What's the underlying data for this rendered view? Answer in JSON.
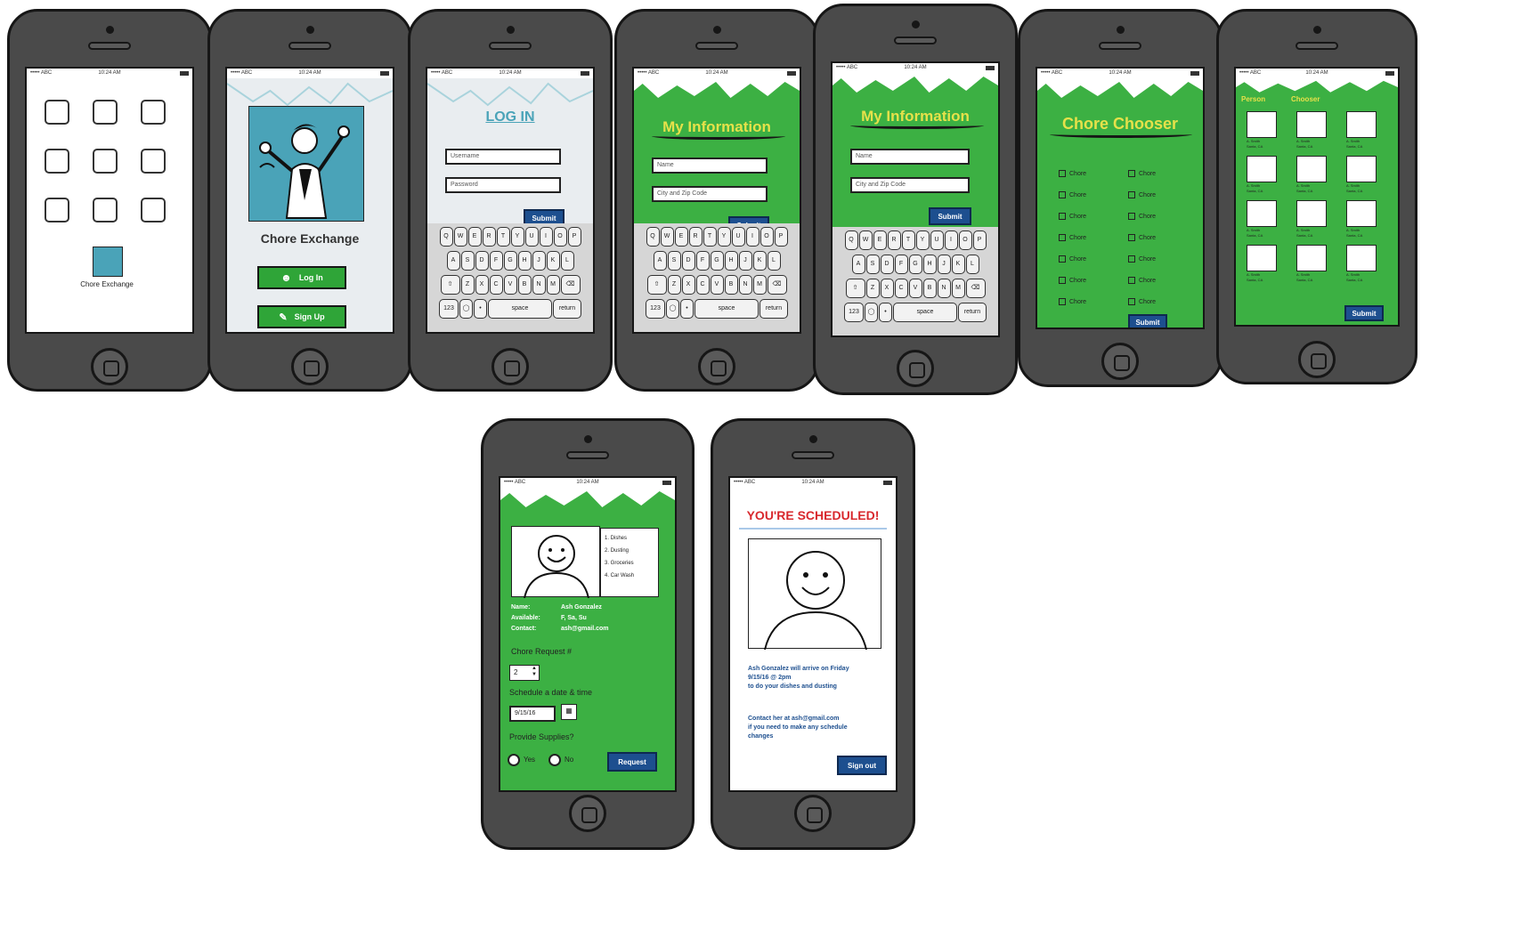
{
  "status_bar": {
    "carrier": "••••• ABC",
    "time": "10:24 AM"
  },
  "colors": {
    "green": "#2fa538",
    "screen_green": "#3cb043",
    "button_blue": "#1d4f8f",
    "teal": "#4aa3b8",
    "title_yellow": "#e6e14a",
    "scheduled_red": "#d8282d",
    "body_blue": "#1d4f8f"
  },
  "home": {
    "app_label": "Chore Exchange",
    "app_icon": "chore-exchange-app-icon"
  },
  "welcome": {
    "app_title": "Chore Exchange",
    "login_label": "Log In",
    "signup_label": "Sign Up",
    "login_icon": "user-icon",
    "signup_icon": "pencil-icon"
  },
  "login": {
    "title": "LOG IN",
    "username_placeholder": "Username",
    "password_placeholder": "Password",
    "submit_label": "Submit"
  },
  "keyboard": {
    "row1": [
      "Q",
      "W",
      "E",
      "R",
      "T",
      "Y",
      "U",
      "I",
      "O",
      "P"
    ],
    "row2": [
      "A",
      "S",
      "D",
      "F",
      "G",
      "H",
      "J",
      "K",
      "L"
    ],
    "row3": [
      "⇧",
      "Z",
      "X",
      "C",
      "V",
      "B",
      "N",
      "M",
      "⌫"
    ],
    "row4_left": "123",
    "space": "space",
    "return": "return"
  },
  "my_info": {
    "title": "My Information",
    "name_placeholder": "Name",
    "city_placeholder": "City and Zip Code",
    "submit_label": "Submit"
  },
  "chooser": {
    "title": "Chore Chooser",
    "chores": [
      "Chore",
      "Chore",
      "Chore",
      "Chore",
      "Chore",
      "Chore",
      "Chore",
      "Chore",
      "Chore",
      "Chore",
      "Chore",
      "Chore",
      "Chore",
      "Chore"
    ],
    "submit_label": "Submit"
  },
  "person_chooser": {
    "title_left": "Person",
    "title_right": "Chooser",
    "people": [
      {
        "name": "A. Smith",
        "loc": "Santa, CA"
      },
      {
        "name": "A. Smith",
        "loc": "Santa, CA"
      },
      {
        "name": "A. Smith",
        "loc": "Santa, CA"
      },
      {
        "name": "A. Smith",
        "loc": "Santa, CA"
      },
      {
        "name": "A. Smith",
        "loc": "Santa, CA"
      },
      {
        "name": "A. Smith",
        "loc": "Santa, CA"
      },
      {
        "name": "A. Smith",
        "loc": "Santa, CA"
      },
      {
        "name": "A. Smith",
        "loc": "Santa, CA"
      },
      {
        "name": "A. Smith",
        "loc": "Santa, CA"
      },
      {
        "name": "A. Smith",
        "loc": "Santa, CA"
      },
      {
        "name": "A. Smith",
        "loc": "Santa, CA"
      },
      {
        "name": "A. Smith",
        "loc": "Santa, CA"
      }
    ],
    "submit_label": "Submit"
  },
  "profile": {
    "chores_list": [
      "1. Dishes",
      "2. Dusting",
      "3. Groceries",
      "4. Car Wash"
    ],
    "name_label": "Name:",
    "name_value": "Ash Gonzalez",
    "available_label": "Available:",
    "available_value": "F, Sa, Su",
    "contact_label": "Contact:",
    "contact_value": "ash@gmail.com",
    "chore_request_label": "Chore Request #",
    "stepper_value": "2",
    "schedule_label": "Schedule a date & time",
    "date_value": "9/15/16",
    "supplies_label": "Provide Supplies?",
    "yes_label": "Yes",
    "no_label": "No",
    "request_label": "Request"
  },
  "scheduled": {
    "title": "YOU'RE SCHEDULED!",
    "line1": "Ash Gonzalez will arrive on Friday",
    "line2": "9/15/16 @ 2pm",
    "line3": "to do your dishes and dusting",
    "line4": "Contact her at ash@gmail.com",
    "line5": "if you need to make any schedule",
    "line6": "changes",
    "signout_label": "Sign out"
  }
}
